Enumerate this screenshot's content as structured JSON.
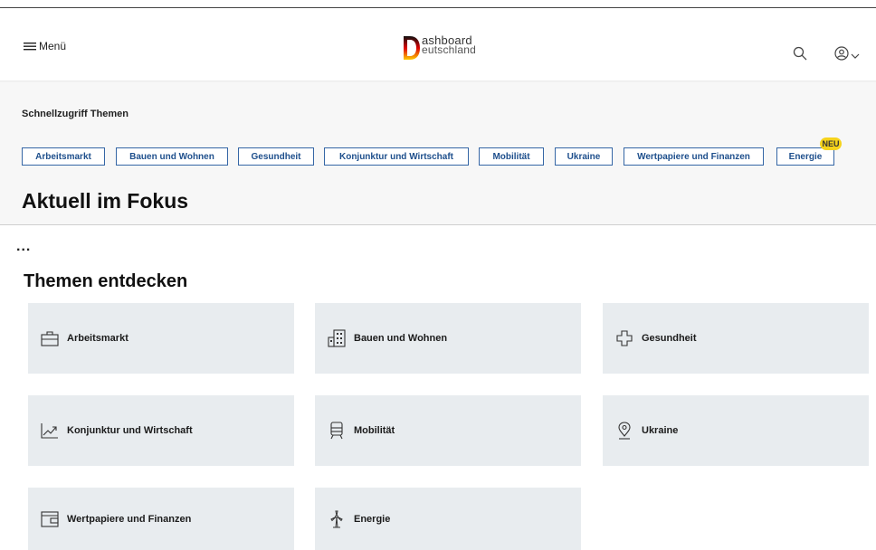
{
  "header": {
    "menu_label": "Menü",
    "logo_letter": "D",
    "logo_line1": "ashboard",
    "logo_line2": "eutschland",
    "logo_colors": [
      "#000000",
      "#dd0000",
      "#ffcc00"
    ]
  },
  "quick_access": {
    "title": "Schnellzugriff Themen",
    "chips": [
      {
        "label": "Arbeitsmarkt"
      },
      {
        "label": "Bauen und Wohnen"
      },
      {
        "label": "Gesundheit"
      },
      {
        "label": "Konjunktur und Wirtschaft"
      },
      {
        "label": "Mobilität"
      },
      {
        "label": "Ukraine"
      },
      {
        "label": "Wertpapiere und Finanzen"
      },
      {
        "label": "Energie",
        "badge": "NEU"
      }
    ]
  },
  "focus": {
    "title": "Aktuell im Fokus",
    "loading": "..."
  },
  "discover": {
    "title": "Themen entdecken",
    "tiles": [
      {
        "label": "Arbeitsmarkt",
        "icon": "briefcase-icon"
      },
      {
        "label": "Bauen und Wohnen",
        "icon": "building-icon"
      },
      {
        "label": "Gesundheit",
        "icon": "medical-cross-icon"
      },
      {
        "label": "Konjunktur und Wirtschaft",
        "icon": "trend-chart-icon"
      },
      {
        "label": "Mobilität",
        "icon": "train-icon"
      },
      {
        "label": "Ukraine",
        "icon": "map-pin-icon"
      },
      {
        "label": "Wertpapiere und Finanzen",
        "icon": "wallet-icon"
      },
      {
        "label": "Energie",
        "icon": "wind-turbine-icon"
      }
    ]
  },
  "colors": {
    "accent": "#1e4f8c",
    "tile_bg": "#e8ecef",
    "band_bg": "#f7f7f7",
    "badge": "#f6d31c"
  }
}
